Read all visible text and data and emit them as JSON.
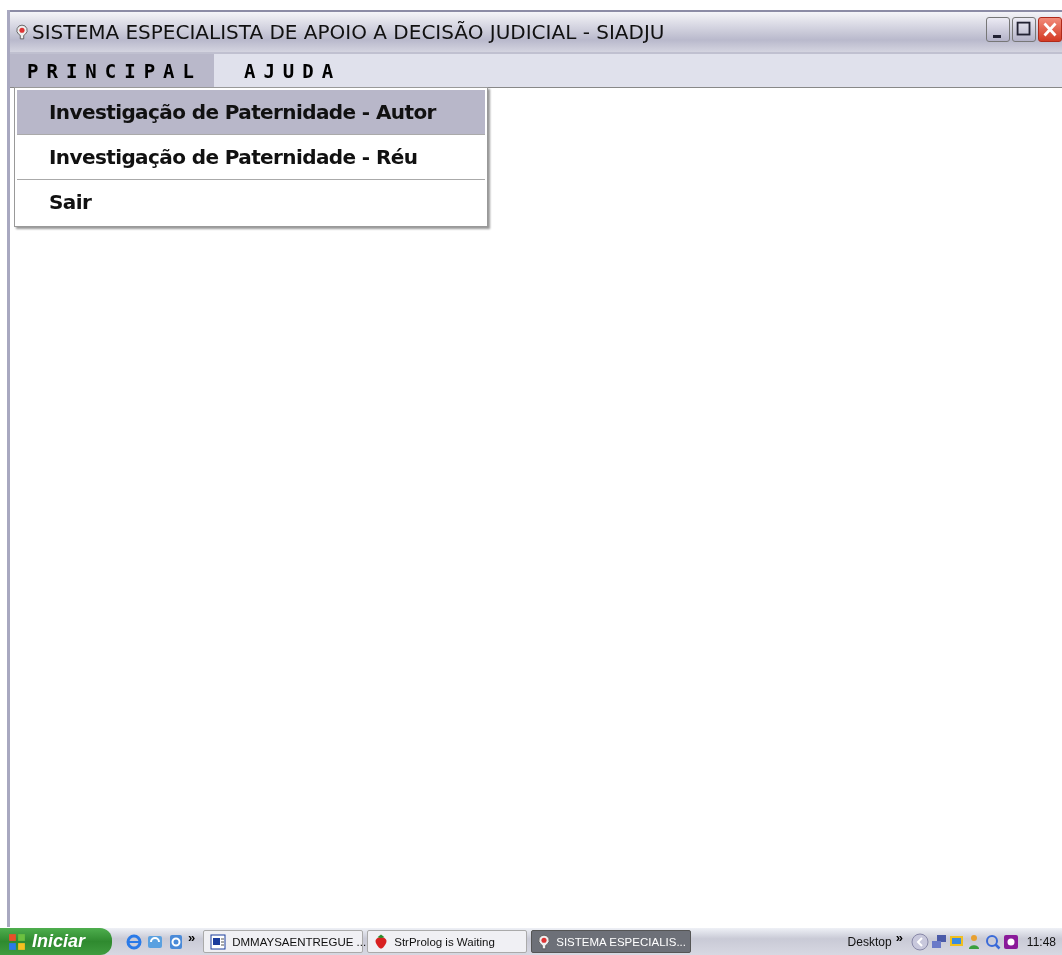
{
  "window": {
    "title": "SISTEMA ESPECIALISTA DE APOIO A DECISÃO JUDICIAL - SIADJU"
  },
  "menu_bar": [
    {
      "label": "PRINCIPAL",
      "selected": true
    },
    {
      "label": "AJUDA",
      "selected": false
    }
  ],
  "dropdown": {
    "items": [
      {
        "label": "Investigação de Paternidade - Autor",
        "selected": true
      },
      {
        "label": "Investigação de Paternidade - Réu",
        "selected": false
      },
      {
        "label": "Sair",
        "selected": false
      }
    ]
  },
  "taskbar": {
    "start": "Iniciar",
    "quick_launch_more": "»",
    "tasks": [
      {
        "label": "DMMAYSAENTREGUE ...",
        "kind": "word",
        "selected": false
      },
      {
        "label": "StrProlog is Waiting",
        "kind": "strawberry",
        "selected": false
      },
      {
        "label": "SISTEMA ESPECIALIS...",
        "kind": "app",
        "selected": true
      }
    ],
    "toolbar": "Desktop",
    "toolbar_more": "»",
    "clock": "11:48"
  }
}
